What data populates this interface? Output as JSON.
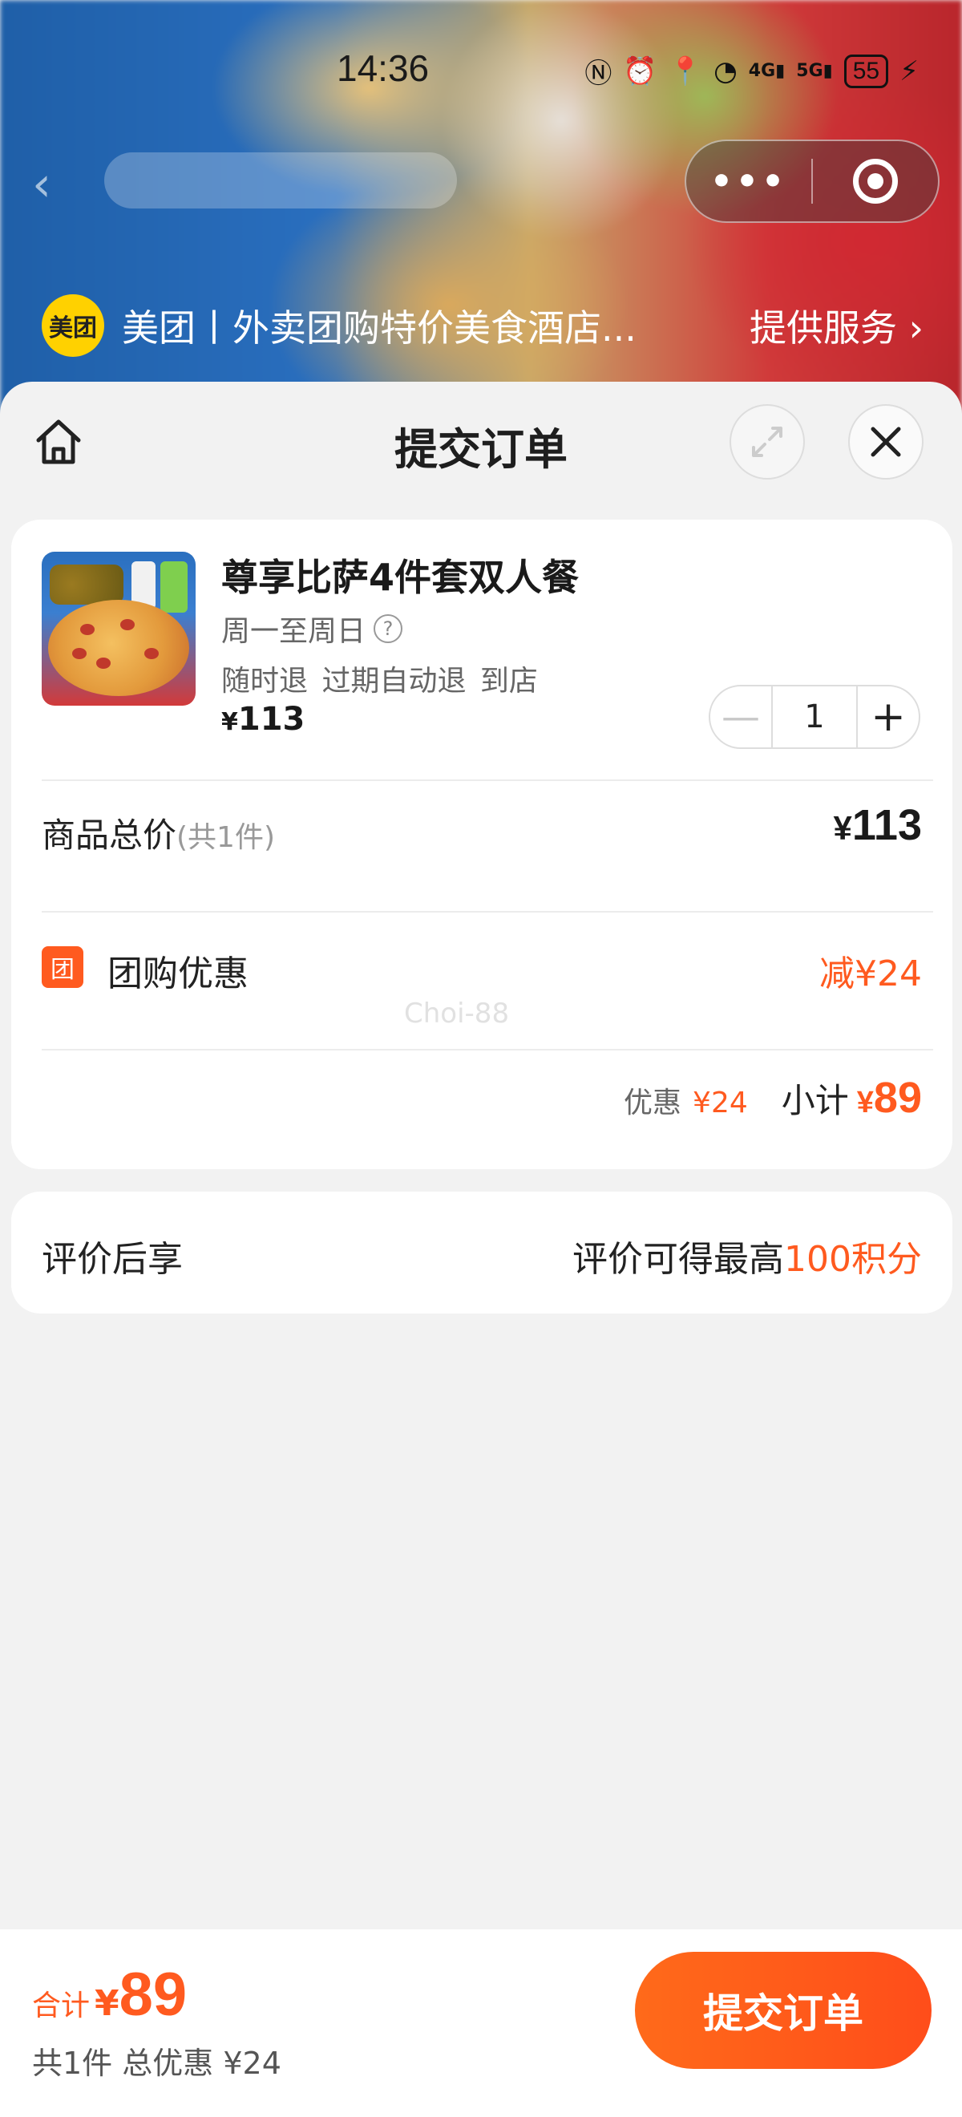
{
  "status_bar": {
    "time": "14:36",
    "battery": "55",
    "net_4g": "4G",
    "net_5g": "5G"
  },
  "capsule": {
    "more_icon": "more-dots-icon",
    "close_icon": "target-circle-icon"
  },
  "provider": {
    "logo_text": "美团",
    "name": "美团丨外卖团购特价美食酒店...",
    "service_label": "提供服务"
  },
  "sheet": {
    "title": "提交订单"
  },
  "product": {
    "name": "尊享比萨4件套双人餐",
    "days": "周一至周日",
    "tags": "随时退 过期自动退 到店",
    "price_yen": "¥",
    "price": "113",
    "quantity": "1"
  },
  "summary": {
    "total_label": "商品总价",
    "total_count": "(共1件)",
    "total_yen": "¥",
    "total_value": "113",
    "group_badge": "团",
    "group_label": "团购优惠",
    "group_value": "减¥24",
    "discount_label": "优惠",
    "discount_value": "¥24",
    "subtotal_label": "小计",
    "subtotal_yen": "¥",
    "subtotal_value": "89"
  },
  "watermark": "Choi-88",
  "review": {
    "label": "评价后享",
    "value_prefix": "评价可得最高",
    "value_highlight": "100积分"
  },
  "bottom": {
    "total_label": "合计",
    "total_yen": "¥",
    "total_value": "89",
    "summary_line": "共1件 总优惠 ¥24",
    "submit_label": "提交订单"
  },
  "colors": {
    "accent": "#ff5a1f",
    "brand_yellow": "#ffd100"
  }
}
